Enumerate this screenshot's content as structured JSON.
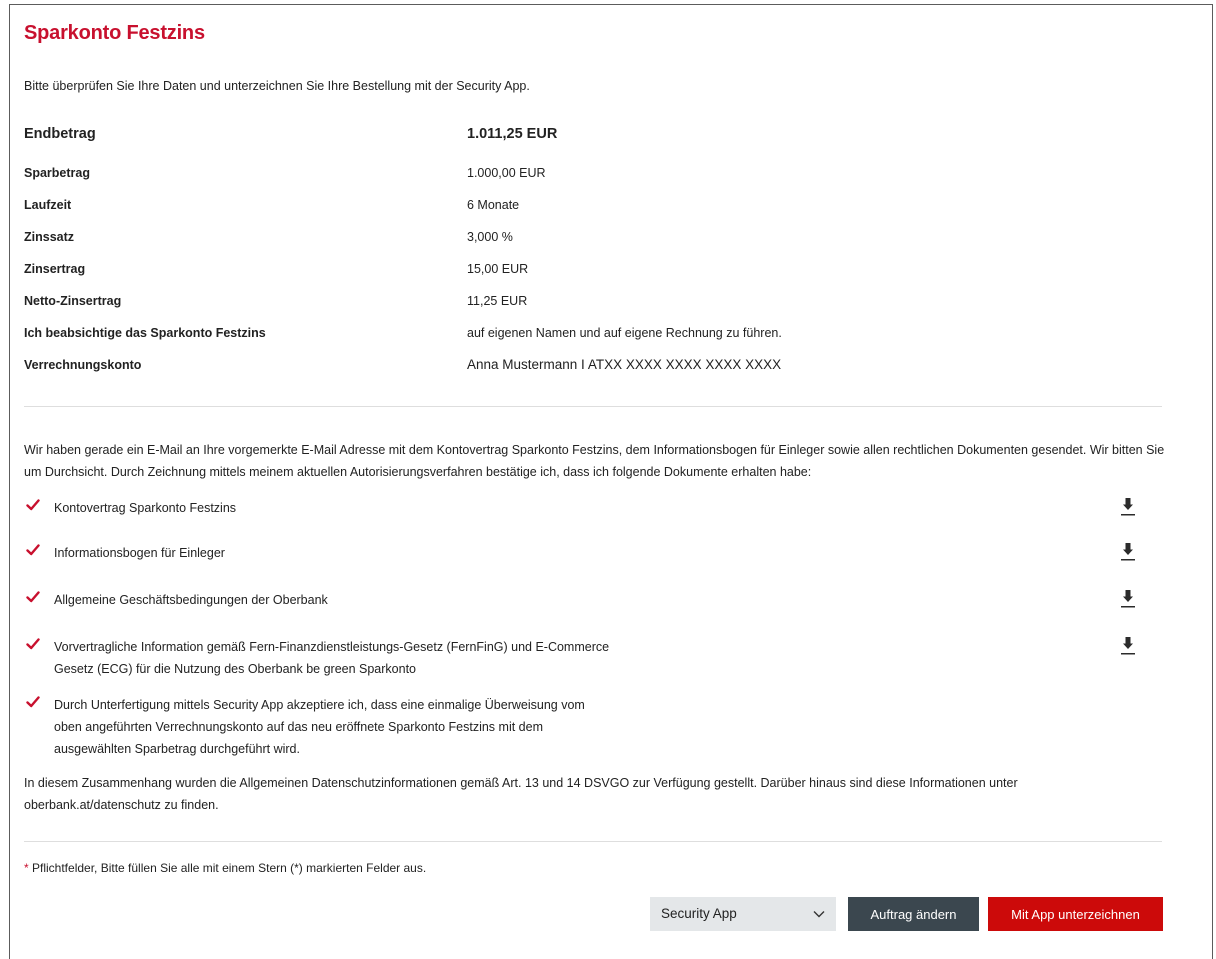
{
  "header": {
    "title": "Sparkonto Festzins"
  },
  "intro": "Bitte überprüfen Sie Ihre Daten und unterzeichnen Sie Ihre Bestellung mit der Security App.",
  "summary": [
    {
      "label": "Endbetrag",
      "value": "1.011,25 EUR"
    },
    {
      "label": "Sparbetrag",
      "value": "1.000,00 EUR"
    },
    {
      "label": "Laufzeit",
      "value": "6 Monate"
    },
    {
      "label": "Zinssatz",
      "value": "3,000 %"
    },
    {
      "label": "Zinsertrag",
      "value": "15,00 EUR"
    },
    {
      "label": "Netto-Zinsertrag",
      "value": "11,25 EUR"
    },
    {
      "label": "Ich beabsichtige das Sparkonto Festzins",
      "value": "auf eigenen Namen und auf eigene Rechnung zu führen."
    },
    {
      "label": "Verrechnungskonto",
      "value": "Anna Mustermann I ATXX XXXX XXXX XXXX XXXX"
    }
  ],
  "email_notice": "Wir haben gerade ein E-Mail an Ihre vorgemerkte E-Mail Adresse mit dem Kontovertrag Sparkonto Festzins, dem Informationsbogen für Einleger sowie allen rechtlichen Dokumenten gesendet. Wir bitten Sie um Durchsicht. Durch Zeichnung mittels meinem aktuellen Autorisierungsverfahren bestätige ich, dass ich folgende Dokumente erhalten habe:",
  "documents": [
    {
      "label": "Kontovertrag Sparkonto Festzins",
      "checked": true,
      "icon": "download-icon"
    },
    {
      "label": "Informationsbogen für Einleger",
      "checked": true,
      "icon": "download-icon"
    },
    {
      "label": "Allgemeine Geschäftsbedingungen der Oberbank",
      "checked": true,
      "icon": "download-icon"
    },
    {
      "label_line1": "Vorvertragliche Information gemäß Fern-Finanzdienstleistungs-Gesetz (FernFinG) und E-Commerce",
      "label_line2": "Gesetz (ECG) für die Nutzung des Oberbank be green Sparkonto",
      "checked": true,
      "icon": "download-icon"
    }
  ],
  "transfer_consent": {
    "line1": "Durch Unterfertigung mittels Security App akzeptiere ich, dass eine einmalige Überweisung vom",
    "line2": "oben angeführten Verrechnungskonto auf das neu eröffnete Sparkonto Festzins mit dem",
    "line3": "ausgewählten Sparbetrag durchgeführt wird.",
    "checked": true
  },
  "privacy_line1": "In diesem Zusammenhang wurden die Allgemeinen Datenschutzinformationen gemäß Art. 13 und 14 DSVGO zur Verfügung gestellt. Darüber hinaus sind diese Informationen unter",
  "privacy_line2": "oberbank.at/datenschutz zu finden.",
  "required_note": {
    "star": "*",
    "text": " Pflichtfelder, Bitte füllen Sie alle mit einem Stern (*) markierten Felder aus."
  },
  "actions": {
    "method_select": "Security App",
    "change_label": "Auftrag ändern",
    "sign_label": "Mit App unterzeichnen"
  },
  "colors": {
    "brand_red": "#c8102e",
    "button_red": "#cc0a0a",
    "button_dark": "#3b474f",
    "select_bg": "#e4e7e9"
  }
}
